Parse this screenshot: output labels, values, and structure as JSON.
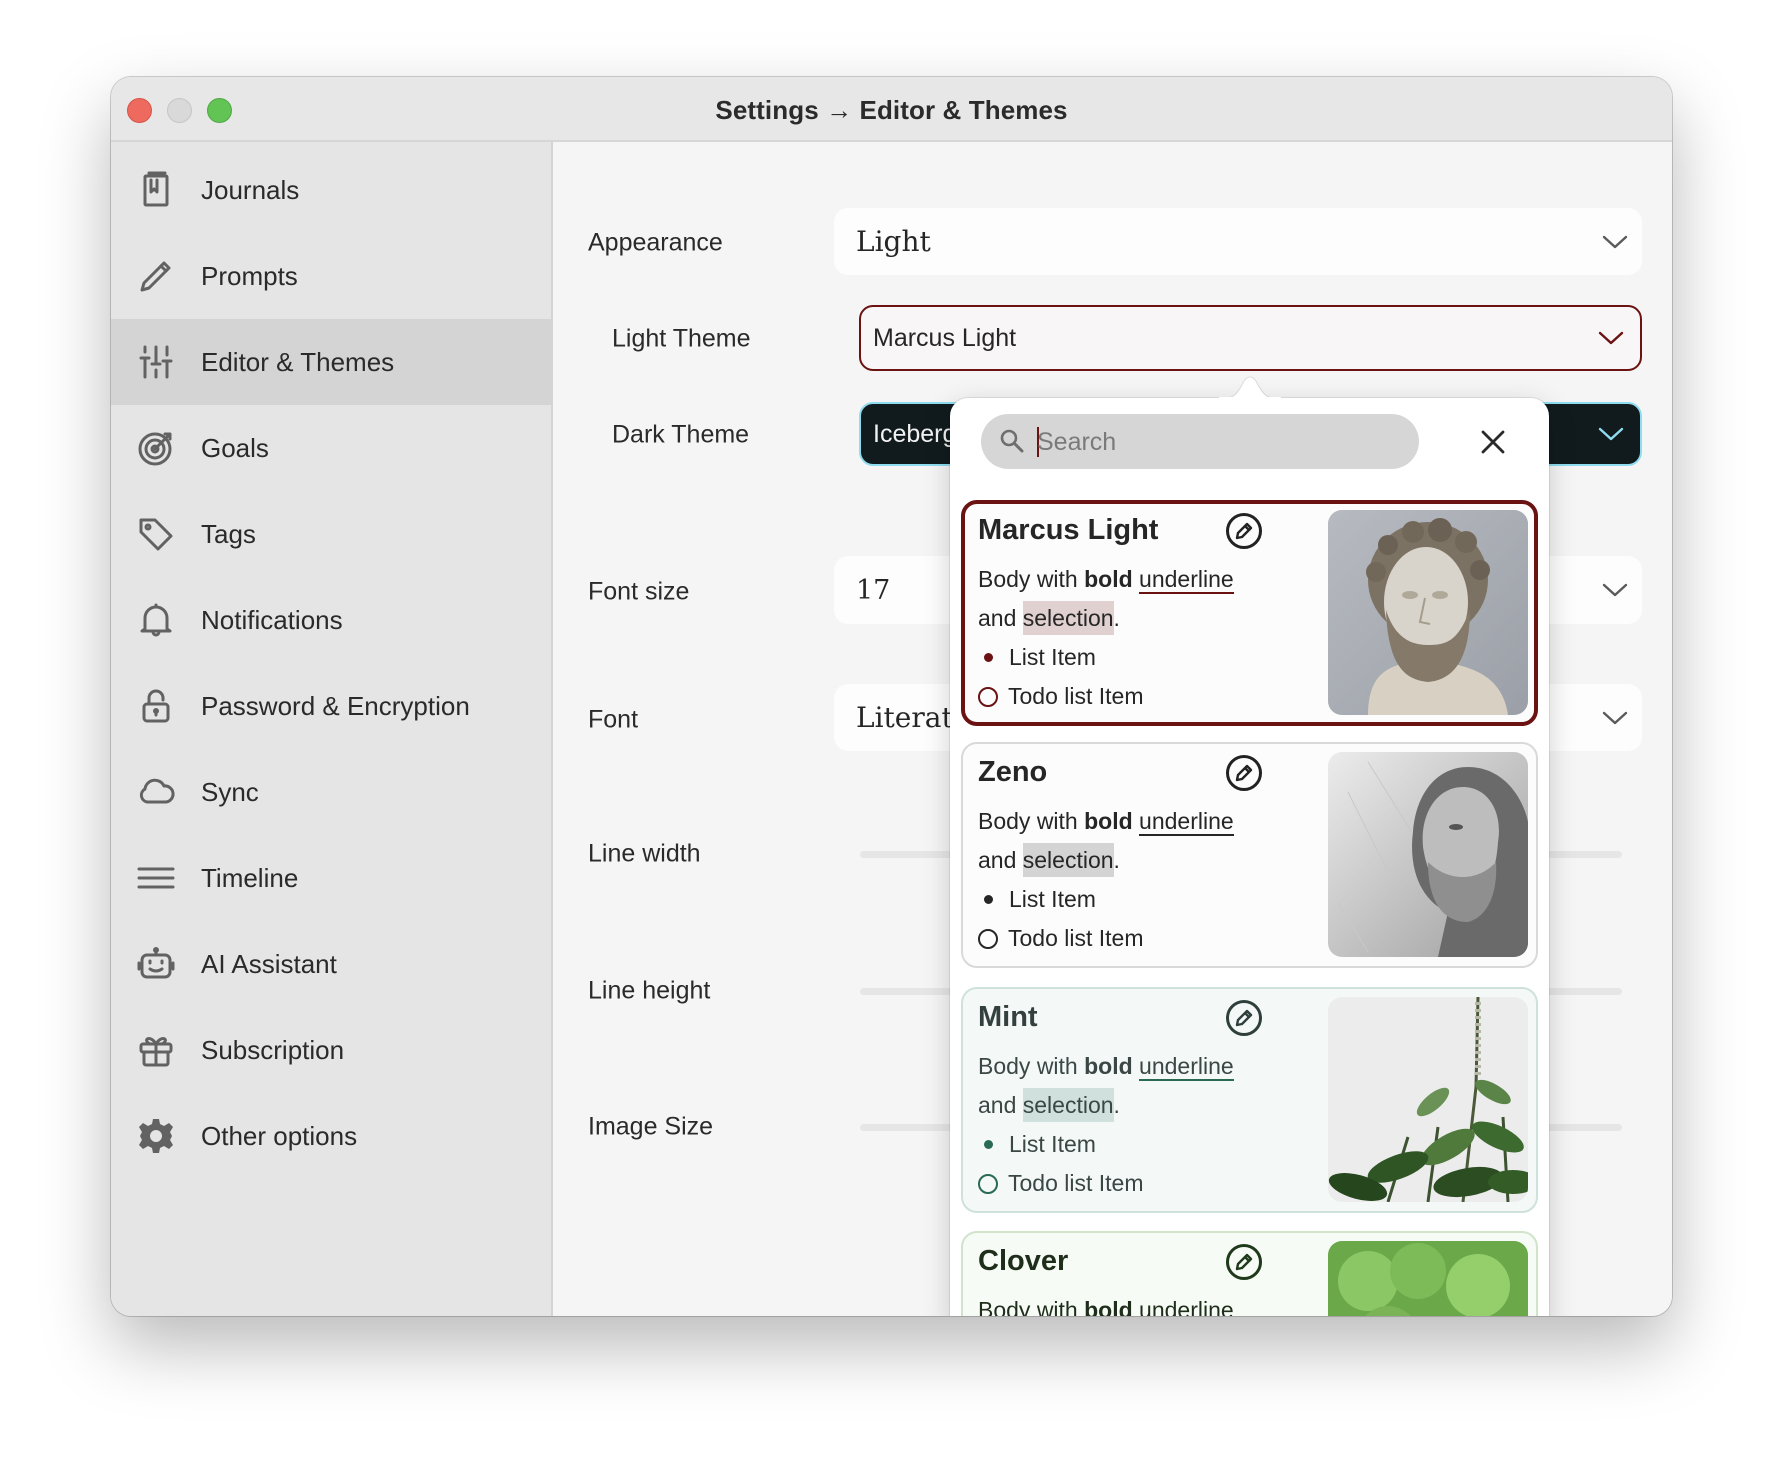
{
  "window": {
    "title": "Settings → Editor & Themes",
    "traffic_lights": [
      "close",
      "minimize",
      "maximize"
    ]
  },
  "sidebar": {
    "selected": "Editor & Themes",
    "items": [
      {
        "label": "Journals",
        "icon": "journal-icon"
      },
      {
        "label": "Prompts",
        "icon": "pencil-icon"
      },
      {
        "label": "Editor & Themes",
        "icon": "sliders-icon"
      },
      {
        "label": "Goals",
        "icon": "target-icon"
      },
      {
        "label": "Tags",
        "icon": "tag-icon"
      },
      {
        "label": "Notifications",
        "icon": "bell-icon"
      },
      {
        "label": "Password & Encryption",
        "icon": "lock-icon"
      },
      {
        "label": "Sync",
        "icon": "cloud-icon"
      },
      {
        "label": "Timeline",
        "icon": "lines-icon"
      },
      {
        "label": "AI Assistant",
        "icon": "robot-icon"
      },
      {
        "label": "Subscription",
        "icon": "gift-icon"
      },
      {
        "label": "Other options",
        "icon": "gear-icon"
      }
    ]
  },
  "settings": {
    "appearance": {
      "label": "Appearance",
      "value": "Light"
    },
    "light_theme": {
      "label": "Light Theme",
      "value": "Marcus Light"
    },
    "dark_theme": {
      "label": "Dark Theme",
      "value": "Iceberg"
    },
    "font_size": {
      "label": "Font size",
      "value": "17"
    },
    "font": {
      "label": "Font",
      "value": "Literata"
    },
    "line_width": {
      "label": "Line width"
    },
    "line_height": {
      "label": "Line height"
    },
    "image_size": {
      "label": "Image Size"
    }
  },
  "theme_picker": {
    "search_placeholder": "Search",
    "search_value": "",
    "preview": {
      "body_prefix": "Body with ",
      "bold": "bold",
      "underline": "underline",
      "line2_prefix": "and ",
      "selection": "selection",
      "line2_suffix": ".",
      "list_item": "List Item",
      "todo_item": "Todo list Item"
    },
    "themes": [
      {
        "name": "Marcus Light",
        "selected": true,
        "accent": "#6b1212",
        "text": "#262626",
        "selection": "#e0d0d0",
        "image": "marble bust of Marcus Aurelius"
      },
      {
        "name": "Zeno",
        "selected": false,
        "accent": "#262626",
        "text": "#262626",
        "selection": "#d4d4d4",
        "image": "marble bust of Zeno"
      },
      {
        "name": "Mint",
        "selected": false,
        "accent": "#2a6a52",
        "text": "#3a4744",
        "selection": "#d0e0dc",
        "image": "mint plant"
      },
      {
        "name": "Clover",
        "selected": false,
        "accent": "#1e3a1a",
        "text": "#1e2e1a",
        "selection": "#d6e6cf",
        "image": "clover leaves"
      }
    ]
  },
  "colors": {
    "accent_light_theme": "#6b1212",
    "dark_theme_bg": "#111b1e",
    "dark_theme_accent": "#8fdcf0"
  }
}
